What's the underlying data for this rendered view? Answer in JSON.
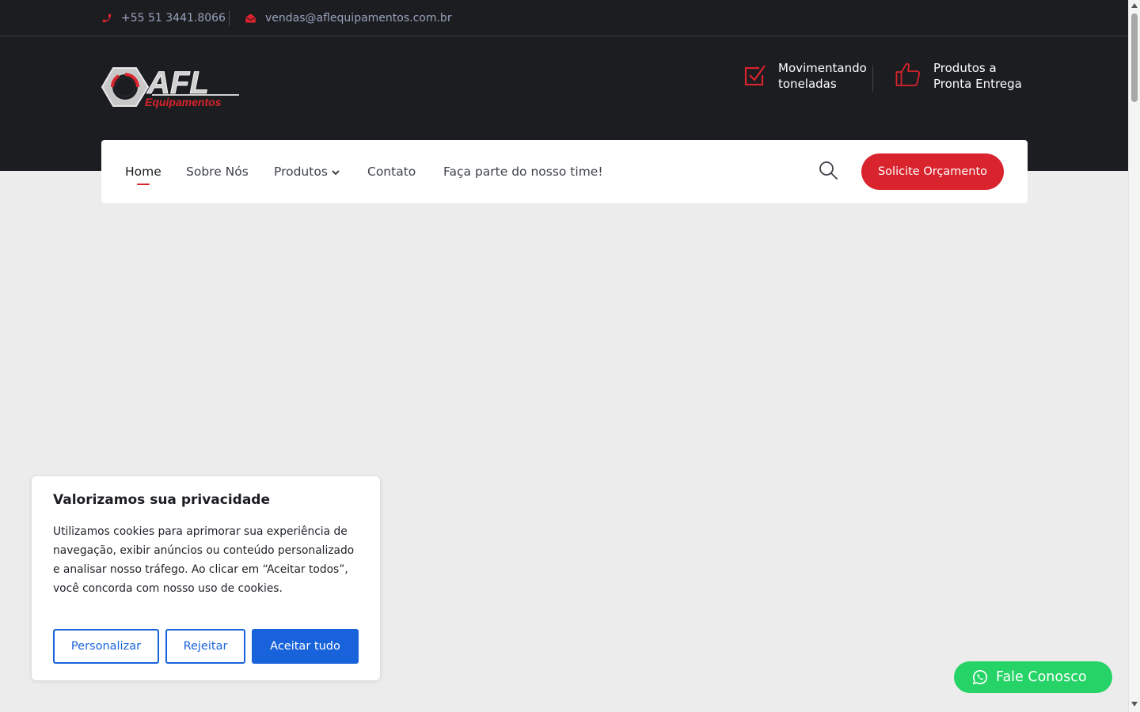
{
  "topbar": {
    "phone": "+55 51 3441.8066",
    "email": "vendas@aflequipamentos.com.br",
    "phone_icon": "phone-icon",
    "email_icon": "envelope-icon"
  },
  "brand": {
    "logo_main": "AFL",
    "logo_sub": "Equipamentos"
  },
  "header_features": [
    {
      "icon": "checkbox-icon",
      "line1": "Movimentando",
      "line2": "toneladas"
    },
    {
      "icon": "thumbs-up-icon",
      "line1": "Produtos a",
      "line2": "Pronta Entrega"
    }
  ],
  "nav": {
    "items": [
      {
        "label": "Home",
        "active": true
      },
      {
        "label": "Sobre Nós"
      },
      {
        "label": "Produtos",
        "has_dropdown": true
      },
      {
        "label": "Contato"
      },
      {
        "label": "Faça parte do nosso time!"
      }
    ],
    "cta": "Solicite Orçamento"
  },
  "cookie_banner": {
    "title": "Valorizamos sua privacidade",
    "text": "Utilizamos cookies para aprimorar sua experiência de navegação, exibir anúncios ou conteúdo personalizado e analisar nosso tráfego. Ao clicar em “Aceitar todos”, você concorda com nosso uso de cookies.",
    "customize": "Personalizar",
    "reject": "Rejeitar",
    "accept_all": "Aceitar tudo"
  },
  "whatsapp": {
    "label": "Fale Conosco",
    "icon": "whatsapp-icon"
  },
  "colors": {
    "dark_bg": "#1b1d20",
    "accent_red": "#d9232d",
    "cookie_blue": "#1863dc",
    "whatsapp_green": "#25d366",
    "page_bg": "#ececec"
  }
}
